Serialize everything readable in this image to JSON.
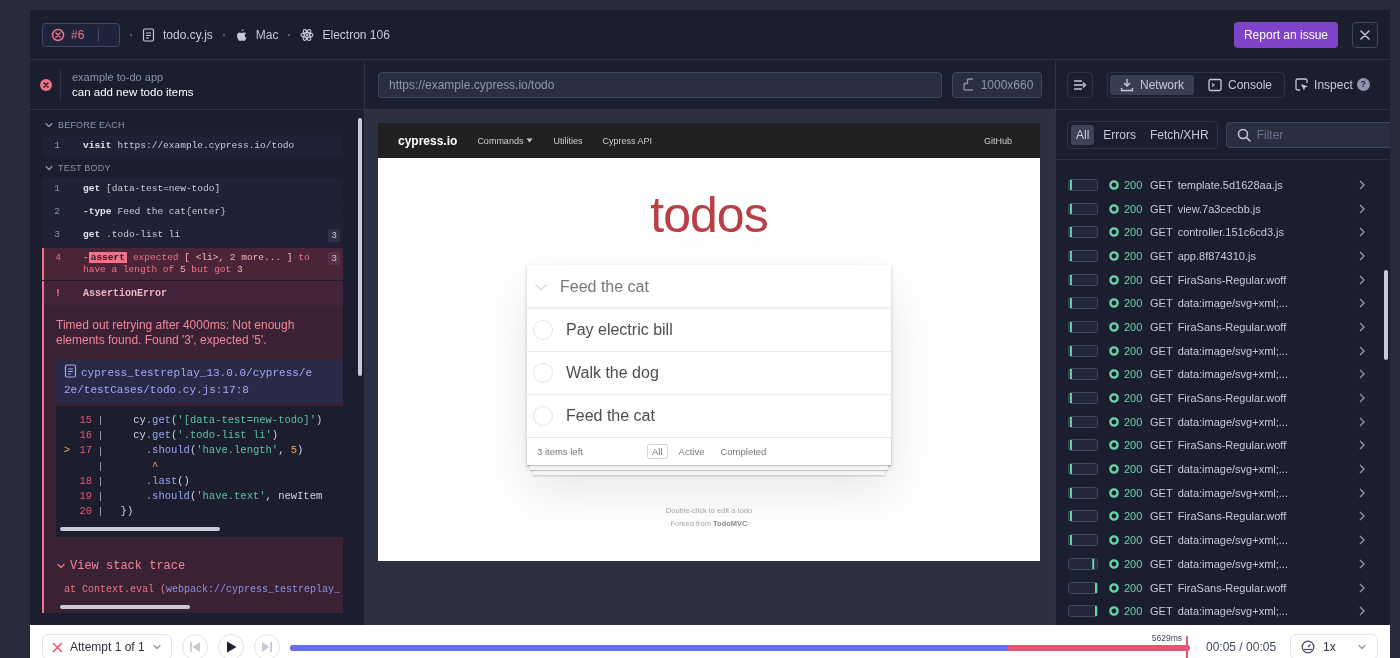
{
  "header": {
    "run": {
      "number": "#6",
      "failed": true
    },
    "spec": "todo.cy.js",
    "os": "Mac",
    "browser": "Electron 106",
    "report_button": "Report an issue"
  },
  "test": {
    "suite": "example to-do app",
    "title": "can add new todo items",
    "failed": true
  },
  "command_log": {
    "sections": [
      {
        "title": "BEFORE EACH",
        "expanded": true,
        "commands": [
          {
            "number": "1",
            "name": "visit",
            "message": "https://example.cypress.io/todo",
            "failed": false
          }
        ]
      },
      {
        "title": "TEST BODY",
        "expanded": true,
        "commands": [
          {
            "number": "1",
            "name": "get",
            "message": "[data-test=new-todo]",
            "failed": false
          },
          {
            "number": "2",
            "name": "-type",
            "message": "Feed the cat{enter}",
            "failed": false
          },
          {
            "number": "3",
            "name": "get",
            "message": ".todo-list li",
            "count": "3",
            "failed": false
          },
          {
            "number": "4",
            "dash": "-",
            "name": "assert",
            "message": "expected **[ <li>, 2 more... ]** to have a length of **5** but got **3**",
            "count": "3",
            "failed": true
          }
        ]
      }
    ],
    "error": {
      "mark": "!",
      "name": "AssertionError",
      "message": "Timed out retrying after 4000ms: Not enough elements found. Found '3', expected '5'.",
      "file_link": "cypress_testreplay_13.0.0/cypress/e2e/testCases/todo.cy.js:17:8",
      "code_lines": [
        {
          "number": "15",
          "tokens": [
            {
              "text": "    cy",
              "kind": "plain"
            },
            {
              "text": ".get",
              "kind": "method"
            },
            {
              "text": "(",
              "kind": "plain"
            },
            {
              "text": "'[data-test=new-todo]'",
              "kind": "string"
            },
            {
              "text": ")",
              "kind": "plain"
            }
          ]
        },
        {
          "number": "16",
          "tokens": [
            {
              "text": "    cy",
              "kind": "plain"
            },
            {
              "text": ".get",
              "kind": "method"
            },
            {
              "text": "(",
              "kind": "plain"
            },
            {
              "text": "'.todo-list li'",
              "kind": "string"
            },
            {
              "text": ")",
              "kind": "plain"
            }
          ]
        },
        {
          "marker": ">",
          "number": "17",
          "tokens": [
            {
              "text": "      .should",
              "kind": "method"
            },
            {
              "text": "(",
              "kind": "plain"
            },
            {
              "text": "'have.length'",
              "kind": "string"
            },
            {
              "text": ", ",
              "kind": "plain"
            },
            {
              "text": "5",
              "kind": "number"
            },
            {
              "text": ")",
              "kind": "plain"
            }
          ]
        },
        {
          "tokens": [
            {
              "text": "       ^",
              "kind": "caret"
            }
          ]
        },
        {
          "number": "18",
          "tokens": [
            {
              "text": "      .last",
              "kind": "method"
            },
            {
              "text": "()",
              "kind": "plain"
            }
          ]
        },
        {
          "number": "19",
          "tokens": [
            {
              "text": "      .should",
              "kind": "method"
            },
            {
              "text": "(",
              "kind": "plain"
            },
            {
              "text": "'have.text'",
              "kind": "string"
            },
            {
              "text": ", newItem",
              "kind": "plain"
            }
          ]
        },
        {
          "number": "20",
          "tokens": [
            {
              "text": "  })",
              "kind": "plain"
            }
          ]
        }
      ],
      "stack_toggle": {
        "label": "View stack trace",
        "expanded": true
      },
      "stack": {
        "text": "at Context.eval (",
        "link": "webpack://cypress_testreplay_"
      }
    }
  },
  "preview": {
    "url": "https://example.cypress.io/todo",
    "viewport": "1000x660",
    "app": {
      "brand": "cypress.io",
      "nav": [
        {
          "label": "Commands",
          "dropdown": true
        },
        {
          "label": "Utilities",
          "dropdown": false
        },
        {
          "label": "Cypress API",
          "dropdown": false
        }
      ],
      "nav_right": "GitHub",
      "heading": "todos",
      "new_todo": "Feed the cat",
      "todos": [
        {
          "text": "Pay electric bill",
          "completed": false
        },
        {
          "text": "Walk the dog",
          "completed": false
        },
        {
          "text": "Feed the cat",
          "completed": false
        }
      ],
      "items_left": "3 items left",
      "filters": [
        {
          "label": "All",
          "selected": true
        },
        {
          "label": "Active",
          "selected": false
        },
        {
          "label": "Completed",
          "selected": false
        }
      ],
      "info": [
        "Double-click to edit a todo",
        "Forked from **TodoMVC**"
      ]
    }
  },
  "devtools": {
    "tabs": [
      {
        "label": "Network",
        "selected": true
      },
      {
        "label": "Console",
        "selected": false
      }
    ],
    "inspect": "Inspect",
    "help": "?",
    "filters": [
      {
        "label": "All",
        "selected": true
      },
      {
        "label": "Errors",
        "selected": false
      },
      {
        "label": "Fetch/XHR",
        "selected": false
      }
    ],
    "filter_placeholder": "Filter",
    "requests": [
      {
        "status": "200",
        "method": "GET",
        "name": "template.5d1628aa.js",
        "level": 0.03
      },
      {
        "status": "200",
        "method": "GET",
        "name": "view.7a3cecbb.js",
        "level": 0.03
      },
      {
        "status": "200",
        "method": "GET",
        "name": "controller.151c6cd3.js",
        "level": 0.03
      },
      {
        "status": "200",
        "method": "GET",
        "name": "app.8f874310.js",
        "level": 0.03
      },
      {
        "status": "200",
        "method": "GET",
        "name": "FiraSans-Regular.woff",
        "level": 0.03
      },
      {
        "status": "200",
        "method": "GET",
        "name": "data:image/svg+xml;...",
        "level": 0.03
      },
      {
        "status": "200",
        "method": "GET",
        "name": "FiraSans-Regular.woff",
        "level": 0.03
      },
      {
        "status": "200",
        "method": "GET",
        "name": "data:image/svg+xml;...",
        "level": 0.03
      },
      {
        "status": "200",
        "method": "GET",
        "name": "data:image/svg+xml;...",
        "level": 0.03
      },
      {
        "status": "200",
        "method": "GET",
        "name": "FiraSans-Regular.woff",
        "level": 0.03
      },
      {
        "status": "200",
        "method": "GET",
        "name": "data:image/svg+xml;...",
        "level": 0.03
      },
      {
        "status": "200",
        "method": "GET",
        "name": "FiraSans-Regular.woff",
        "level": 0.03
      },
      {
        "status": "200",
        "method": "GET",
        "name": "data:image/svg+xml;...",
        "level": 0.03
      },
      {
        "status": "200",
        "method": "GET",
        "name": "data:image/svg+xml;...",
        "level": 0.03
      },
      {
        "status": "200",
        "method": "GET",
        "name": "FiraSans-Regular.woff",
        "level": 0.03
      },
      {
        "status": "200",
        "method": "GET",
        "name": "data:image/svg+xml;...",
        "level": 0.03
      },
      {
        "status": "200",
        "method": "GET",
        "name": "data:image/svg+xml;...",
        "level": 0.88
      },
      {
        "status": "200",
        "method": "GET",
        "name": "FiraSans-Regular.woff",
        "level": 1
      },
      {
        "status": "200",
        "method": "GET",
        "name": "data:image/svg+xml;...",
        "level": 1
      }
    ]
  },
  "playback": {
    "attempt": "Attempt 1 of 1",
    "attempt_failed": true,
    "timeline": {
      "level": 0.798
    },
    "playhead": {
      "level": 0.998,
      "label": "5629ms"
    },
    "time": "00:05 / 00:05",
    "speed": "1x"
  }
}
